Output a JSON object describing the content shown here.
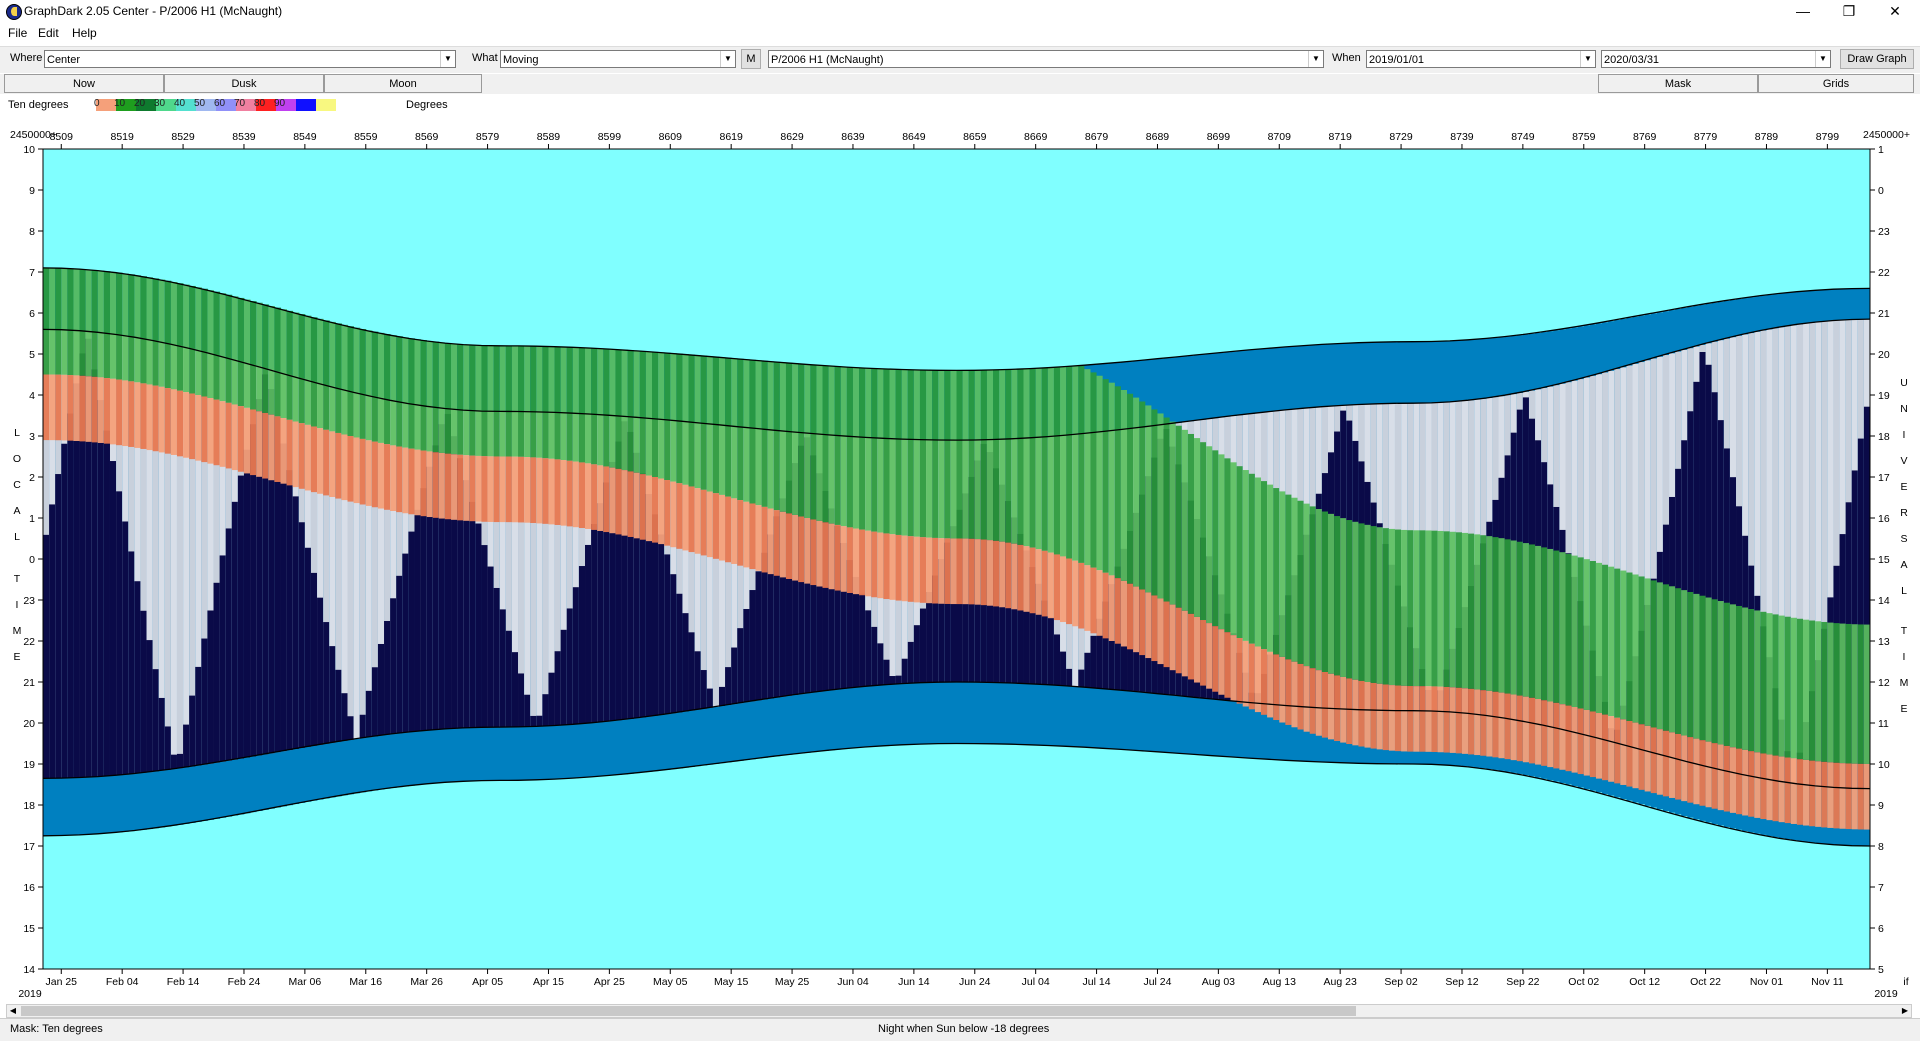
{
  "window": {
    "title": "GraphDark 2.05  Center  -  P/2006 H1 (McNaught)",
    "minimize_glyph": "—",
    "restore_glyph": "❐",
    "close_glyph": "✕"
  },
  "menu": [
    "File",
    "Edit",
    "Help"
  ],
  "toolbar": {
    "where_label": "Where",
    "where_value": "Center",
    "what_label": "What",
    "what_value": "Moving",
    "m_button": "M",
    "object_value": "P/2006 H1 (McNaught)",
    "when_label": "When",
    "start_date": "2019/01/01",
    "end_date": "2020/03/31",
    "draw_button": "Draw Graph"
  },
  "tabs": {
    "now": "Now",
    "dusk": "Dusk",
    "moon": "Moon",
    "mask": "Mask",
    "grids": "Grids"
  },
  "legend": {
    "label": "Ten degrees",
    "unit": "Degrees",
    "colors": [
      "#f5a07a",
      "#1e9e1e",
      "#0e7a2e",
      "#4fd88c",
      "#54e0d0",
      "#a0b8f0",
      "#9090f8",
      "#f080a0",
      "#ff2020",
      "#c040f0",
      "#1010ff",
      "#f8f880"
    ],
    "ticks": [
      "0",
      "10",
      "20",
      "30",
      "40",
      "50",
      "60",
      "70",
      "80",
      "90"
    ]
  },
  "chart_data": {
    "type": "heatmap",
    "top_axis_prefix_left": "2450000+",
    "top_axis_prefix_right": "2450000+",
    "jd_labels": [
      "8509",
      "8519",
      "8529",
      "8539",
      "8549",
      "8559",
      "8569",
      "8579",
      "8589",
      "8599",
      "8609",
      "8619",
      "8629",
      "8639",
      "8649",
      "8659",
      "8669",
      "8679",
      "8689",
      "8699",
      "8709",
      "8719",
      "8729",
      "8739",
      "8749",
      "8759",
      "8769",
      "8779",
      "8789",
      "8799"
    ],
    "date_labels": [
      "Jan 25",
      "Feb 04",
      "Feb 14",
      "Feb 24",
      "Mar 06",
      "Mar 16",
      "Mar 26",
      "Apr 05",
      "Apr 15",
      "Apr 25",
      "May 05",
      "May 15",
      "May 25",
      "Jun 04",
      "Jun 14",
      "Jun 24",
      "Jul 04",
      "Jul 14",
      "Jul 24",
      "Aug 03",
      "Aug 13",
      "Aug 23",
      "Sep 02",
      "Sep 12",
      "Sep 22",
      "Oct 02",
      "Oct 12",
      "Oct 22",
      "Nov 01",
      "Nov 11"
    ],
    "year_left": "2019",
    "year_right": "2019",
    "corner_right": "if",
    "left_axis_title": "LOCAL TIME",
    "right_axis_title": "UNIVERSAL TIME",
    "left_ticks": [
      "10",
      "9",
      "8",
      "7",
      "6",
      "5",
      "4",
      "3",
      "2",
      "1",
      "0",
      "23",
      "22",
      "21",
      "20",
      "19",
      "18",
      "17",
      "16",
      "15",
      "14"
    ],
    "right_ticks": [
      "1",
      "0",
      "23",
      "22",
      "21",
      "20",
      "19",
      "18",
      "17",
      "16",
      "15",
      "14",
      "13",
      "12",
      "11",
      "10",
      "9",
      "8",
      "7",
      "6",
      "5"
    ],
    "x_range_jd": [
      2458506,
      2458806
    ],
    "y_range_hours_local": [
      14,
      34
    ],
    "background_colors": {
      "daylight": "#80ffff",
      "night": "#0a0a48",
      "twilight": "#0080c0",
      "moonlight": "#c8d0dc",
      "altitude_low": "#f5a07a",
      "altitude_mid": "#30a040"
    },
    "curves": {
      "sunset_local_hr": [
        17.25,
        18.6,
        19.5,
        19.0,
        17.0
      ],
      "dusk_local_hr": [
        18.65,
        19.9,
        21.0,
        20.3,
        18.4
      ],
      "dawn_local_hr": [
        29.6,
        27.6,
        26.9,
        27.8,
        29.85
      ],
      "sunrise_local_hr": [
        31.1,
        29.2,
        28.6,
        29.3,
        30.6
      ],
      "object_rise_local_hr": [
        28.5,
        24.5,
        20.9,
        19.0
      ],
      "object_set_local_hr": [
        29.6,
        26.7,
        21.9,
        19.6
      ]
    }
  },
  "status": {
    "mask": "Mask:  Ten degrees",
    "night_rule": "Night when Sun below -18 degrees"
  }
}
